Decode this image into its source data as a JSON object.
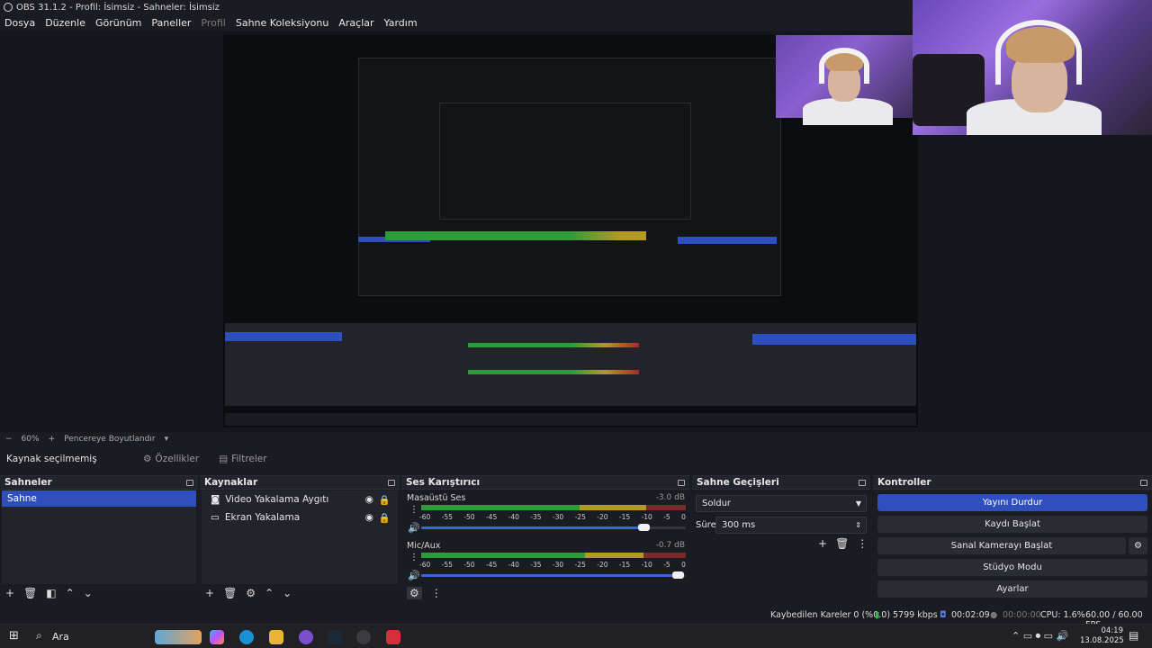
{
  "window": {
    "title": "OBS 31.1.2 - Profil: İsimsiz - Sahneler: İsimsiz"
  },
  "menu": [
    "Dosya",
    "Düzenle",
    "Görünüm",
    "Paneller",
    "Profil",
    "Sahne Koleksiyonu",
    "Araçlar",
    "Yardım"
  ],
  "zoom": {
    "minus": "−",
    "value": "60%",
    "plus": "+",
    "fit_label": "Pencereye Boyutlandır"
  },
  "source_bar": {
    "status": "Kaynak seçilmemiş",
    "properties": "Özellikler",
    "filters": "Filtreler"
  },
  "scenes": {
    "title": "Sahneler",
    "items": [
      "Sahne"
    ]
  },
  "sources": {
    "title": "Kaynaklar",
    "items": [
      "Video Yakalama Aygıtı",
      "Ekran Yakalama"
    ]
  },
  "mixer": {
    "title": "Ses Karıştırıcı",
    "channels": [
      {
        "name": "Masaüstü Ses",
        "db": "-3.0 dB",
        "volume": 0.84
      },
      {
        "name": "Mic/Aux",
        "db": "-0.7 dB",
        "volume": 0.97
      }
    ],
    "ticks": [
      "-60",
      "-55",
      "-50",
      "-45",
      "-40",
      "-35",
      "-30",
      "-25",
      "-20",
      "-15",
      "-10",
      "-5",
      "0"
    ]
  },
  "transitions": {
    "title": "Sahne Geçişleri",
    "selected": "Soldur",
    "duration_label": "Süre",
    "duration": "300 ms"
  },
  "controls": {
    "title": "Kontroller",
    "stop_stream": "Yayını Durdur",
    "start_record": "Kaydı Başlat",
    "virtual_cam": "Sanal Kamerayı Başlat",
    "studio": "Stüdyo Modu",
    "settings": "Ayarlar"
  },
  "status": {
    "dropped": "Kaybedilen Kareler 0 (%0.0)",
    "bitrate": "5799 kbps",
    "stream_time": "00:02:09",
    "rec_time": "00:00:00",
    "cpu": "CPU: 1.6%",
    "fps": "60.00 / 60.00 FPS"
  },
  "taskbar": {
    "search": "Ara",
    "time": "04:19",
    "date": "13.08.2025"
  },
  "colors": {
    "accent": "#2f4fbf",
    "bg": "#1b1c22",
    "panel": "#22232b"
  }
}
